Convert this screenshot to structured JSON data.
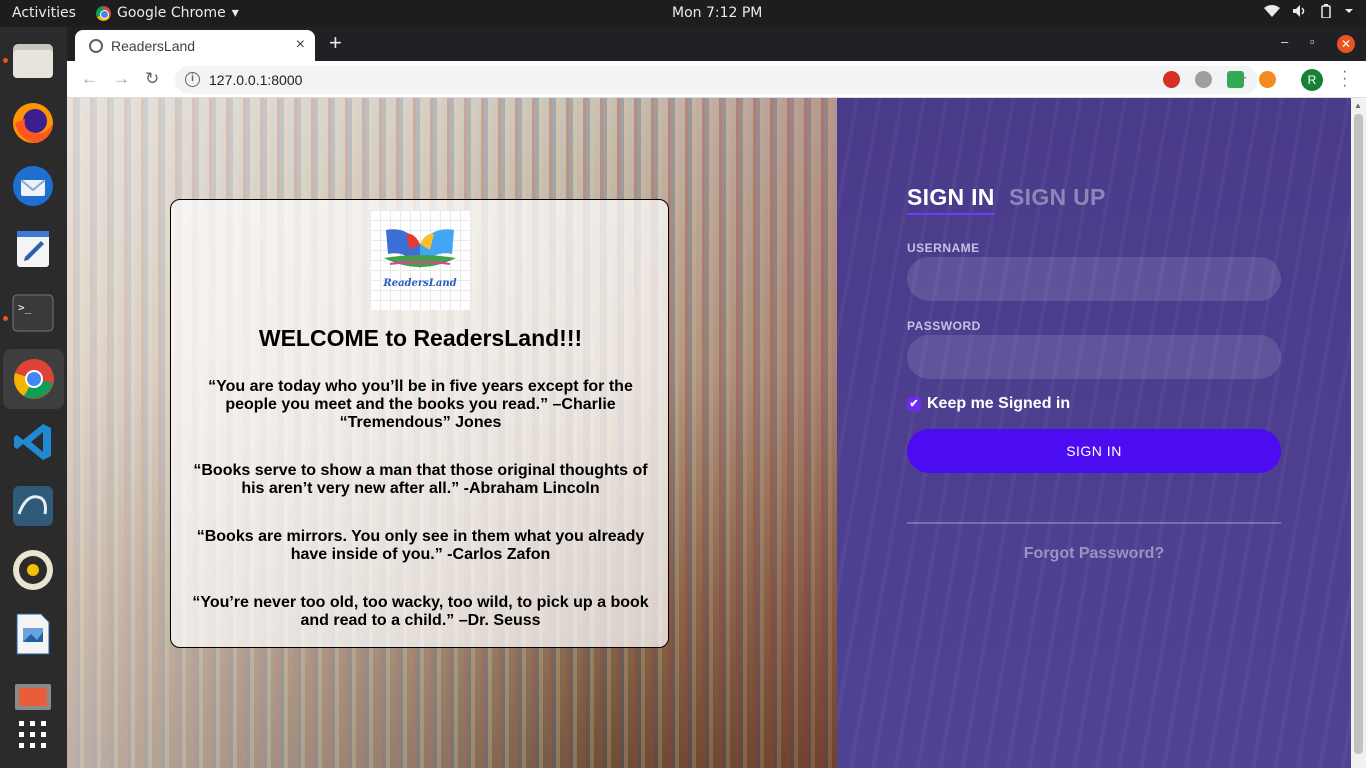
{
  "topbar": {
    "activities": "Activities",
    "app_name": "Google Chrome",
    "app_menu_arrow": "▾",
    "clock": "Mon  7:12 PM"
  },
  "dock": {
    "items": [
      "files",
      "firefox",
      "thunderbird",
      "text-editor",
      "terminal",
      "chrome",
      "vscode",
      "mysql-workbench",
      "rhythmbox",
      "libreoffice-impress",
      "impress-presentation",
      "show-applications"
    ]
  },
  "browser": {
    "tab_title": "ReadersLand",
    "tab_close": "×",
    "new_tab": "+",
    "url": "127.0.0.1:8000",
    "profile_initial": "R",
    "window_minimize": "–",
    "window_maximize": "▫",
    "window_close": "✕"
  },
  "welcome_card": {
    "logo_text": "ReadersLand",
    "heading": "WELCOME to ReadersLand!!!",
    "quotes": [
      "“You are today who you’ll be in five years except for the people you meet and the books you read.” –Charlie “Tremendous” Jones",
      "“Books serve to show a man that those original thoughts of his aren’t very new after all.” -Abraham Lincoln",
      "“Books are mirrors. You only see in them what you already have inside of you.” -Carlos Zafon",
      "“You’re never too old, too wacky, too wild, to pick up a book and read to a child.” –Dr. Seuss"
    ]
  },
  "login": {
    "tab_signin": "SIGN IN",
    "tab_signup": "SIGN UP",
    "username_label": "USERNAME",
    "username_value": "",
    "password_label": "PASSWORD",
    "password_value": "",
    "keep_signed_in": "Keep me Signed in",
    "keep_signed_in_checked": true,
    "signin_button": "SIGN IN",
    "forgot_password": "Forgot Password?"
  },
  "colors": {
    "accent": "#4b0cf2",
    "panel": "#4d3e8f",
    "ubuntu_orange": "#e95420"
  }
}
